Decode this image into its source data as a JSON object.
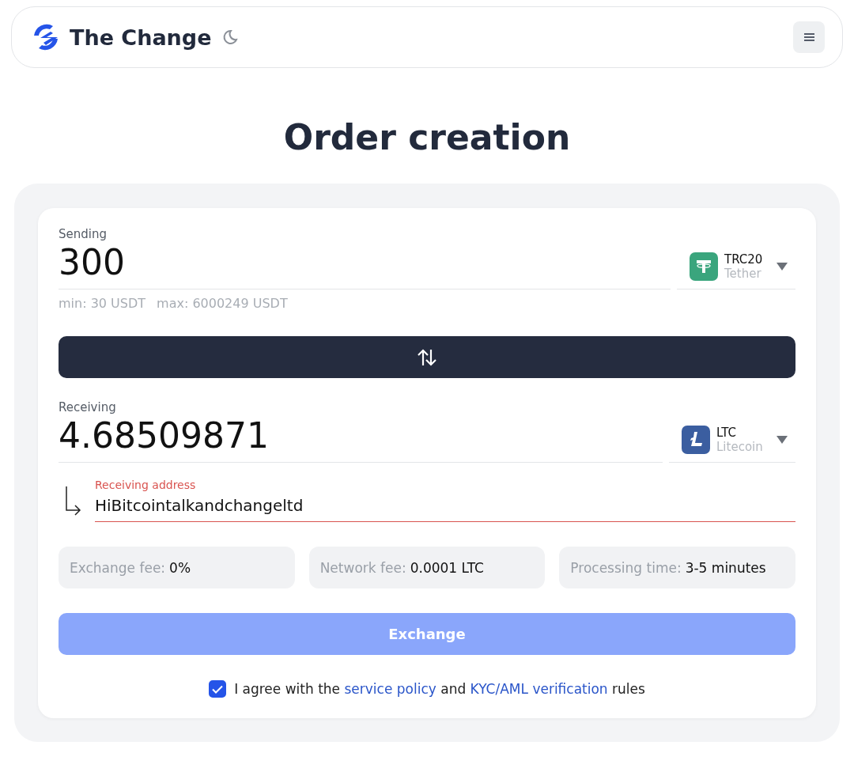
{
  "header": {
    "brand": "The Change"
  },
  "title": "Order creation",
  "sending": {
    "label": "Sending",
    "value": "300",
    "currency": {
      "kind": "tether",
      "code": "TRC20",
      "name": "Tether"
    },
    "limits": [
      "min: 30 USDT",
      "max: 6000249 USDT"
    ]
  },
  "receiving": {
    "label": "Receiving",
    "value": "4.68509871",
    "currency": {
      "kind": "litecoin",
      "code": "LTC",
      "name": "Litecoin"
    }
  },
  "address": {
    "label": "Receiving address",
    "value": "HiBitcointalkandchangeltd",
    "error": true
  },
  "fees": [
    {
      "label": "Exchange fee:",
      "value": "0%"
    },
    {
      "label": "Network fee:",
      "value": "0.0001 LTC"
    },
    {
      "label": "Processing time:",
      "value": "3-5 minutes"
    }
  ],
  "exchange_button": {
    "label": "Exchange",
    "disabled": true
  },
  "agreement": {
    "checked": true,
    "before": "I agree with the",
    "link_1": "service policy",
    "middle": "and",
    "link_2": "KYC/AML verification",
    "after": "rules"
  }
}
